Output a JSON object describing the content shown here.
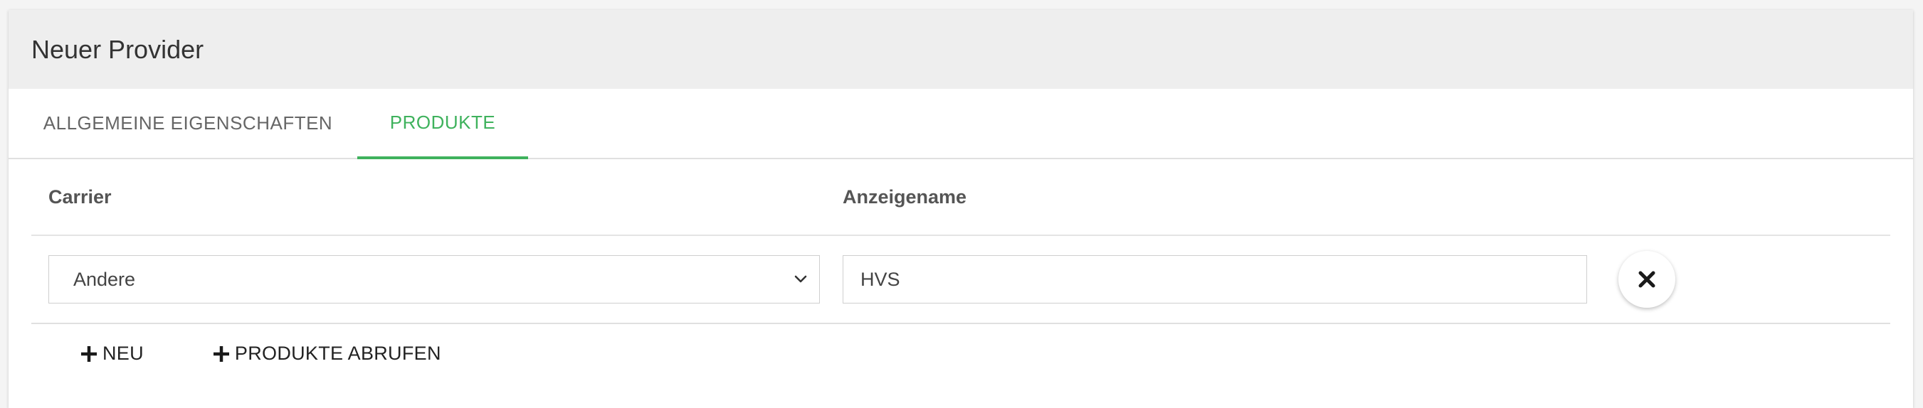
{
  "header": {
    "title": "Neuer Provider"
  },
  "tabs": [
    {
      "label": "ALLGEMEINE EIGENSCHAFTEN",
      "active": false
    },
    {
      "label": "PRODUKTE",
      "active": true
    }
  ],
  "table": {
    "columns": {
      "carrier": "Carrier",
      "display_name": "Anzeigename"
    },
    "rows": [
      {
        "carrier": "Andere",
        "display_name": "HVS"
      }
    ]
  },
  "actions": {
    "new_label": "NEU",
    "fetch_label": "PRODUKTE ABRUFEN"
  },
  "icons": {
    "remove": "close-icon",
    "select_arrow": "chevron-down-icon",
    "add": "plus-icon"
  },
  "colors": {
    "accent": "#3fb25d",
    "header_bg": "#eeeeee"
  }
}
